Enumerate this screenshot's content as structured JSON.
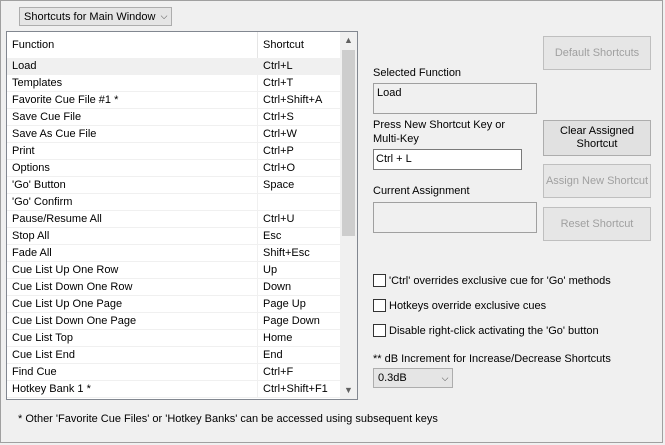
{
  "shortcut_set": {
    "selected": "Shortcuts for Main Window"
  },
  "list": {
    "columns": [
      "Function",
      "Shortcut"
    ],
    "rows": [
      {
        "function": "Load",
        "shortcut": "Ctrl+L"
      },
      {
        "function": "Templates",
        "shortcut": "Ctrl+T"
      },
      {
        "function": "Favorite Cue File #1 *",
        "shortcut": "Ctrl+Shift+A"
      },
      {
        "function": "Save Cue File",
        "shortcut": "Ctrl+S"
      },
      {
        "function": "Save As Cue File",
        "shortcut": "Ctrl+W"
      },
      {
        "function": "Print",
        "shortcut": "Ctrl+P"
      },
      {
        "function": "Options",
        "shortcut": "Ctrl+O"
      },
      {
        "function": "'Go' Button",
        "shortcut": "Space"
      },
      {
        "function": "'Go' Confirm",
        "shortcut": ""
      },
      {
        "function": "Pause/Resume All",
        "shortcut": "Ctrl+U"
      },
      {
        "function": "Stop All",
        "shortcut": "Esc"
      },
      {
        "function": "Fade All",
        "shortcut": "Shift+Esc"
      },
      {
        "function": "Cue List Up One Row",
        "shortcut": "Up"
      },
      {
        "function": "Cue List Down One Row",
        "shortcut": "Down"
      },
      {
        "function": "Cue List Up One Page",
        "shortcut": "Page Up"
      },
      {
        "function": "Cue List Down One Page",
        "shortcut": "Page Down"
      },
      {
        "function": "Cue List Top",
        "shortcut": "Home"
      },
      {
        "function": "Cue List End",
        "shortcut": "End"
      },
      {
        "function": "Find Cue",
        "shortcut": "Ctrl+F"
      },
      {
        "function": "Hotkey Bank 1 *",
        "shortcut": "Ctrl+Shift+F1"
      }
    ]
  },
  "right": {
    "default_shortcuts": "Default Shortcuts",
    "selected_function_label": "Selected Function",
    "selected_function_value": "Load",
    "press_new_label_1": "Press New Shortcut Key or",
    "press_new_label_2": "Multi-Key",
    "new_key_value": "Ctrl + L",
    "clear_assigned_1": "Clear Assigned",
    "clear_assigned_2": "Shortcut",
    "current_assignment_label": "Current Assignment",
    "current_assignment_value": "",
    "assign_new": "Assign New Shortcut",
    "reset_shortcut": "Reset Shortcut"
  },
  "options": {
    "ctrl_overrides": "'Ctrl' overrides exclusive cue for 'Go' methods",
    "hotkeys_override": "Hotkeys override exclusive cues",
    "disable_right_click": "Disable right-click activating the 'Go' button",
    "db_increment_label": "** dB Increment for Increase/Decrease Shortcuts",
    "db_increment_value": "0.3dB"
  },
  "footnote": "* Other 'Favorite Cue Files' or 'Hotkey Banks' can be accessed using subsequent keys"
}
